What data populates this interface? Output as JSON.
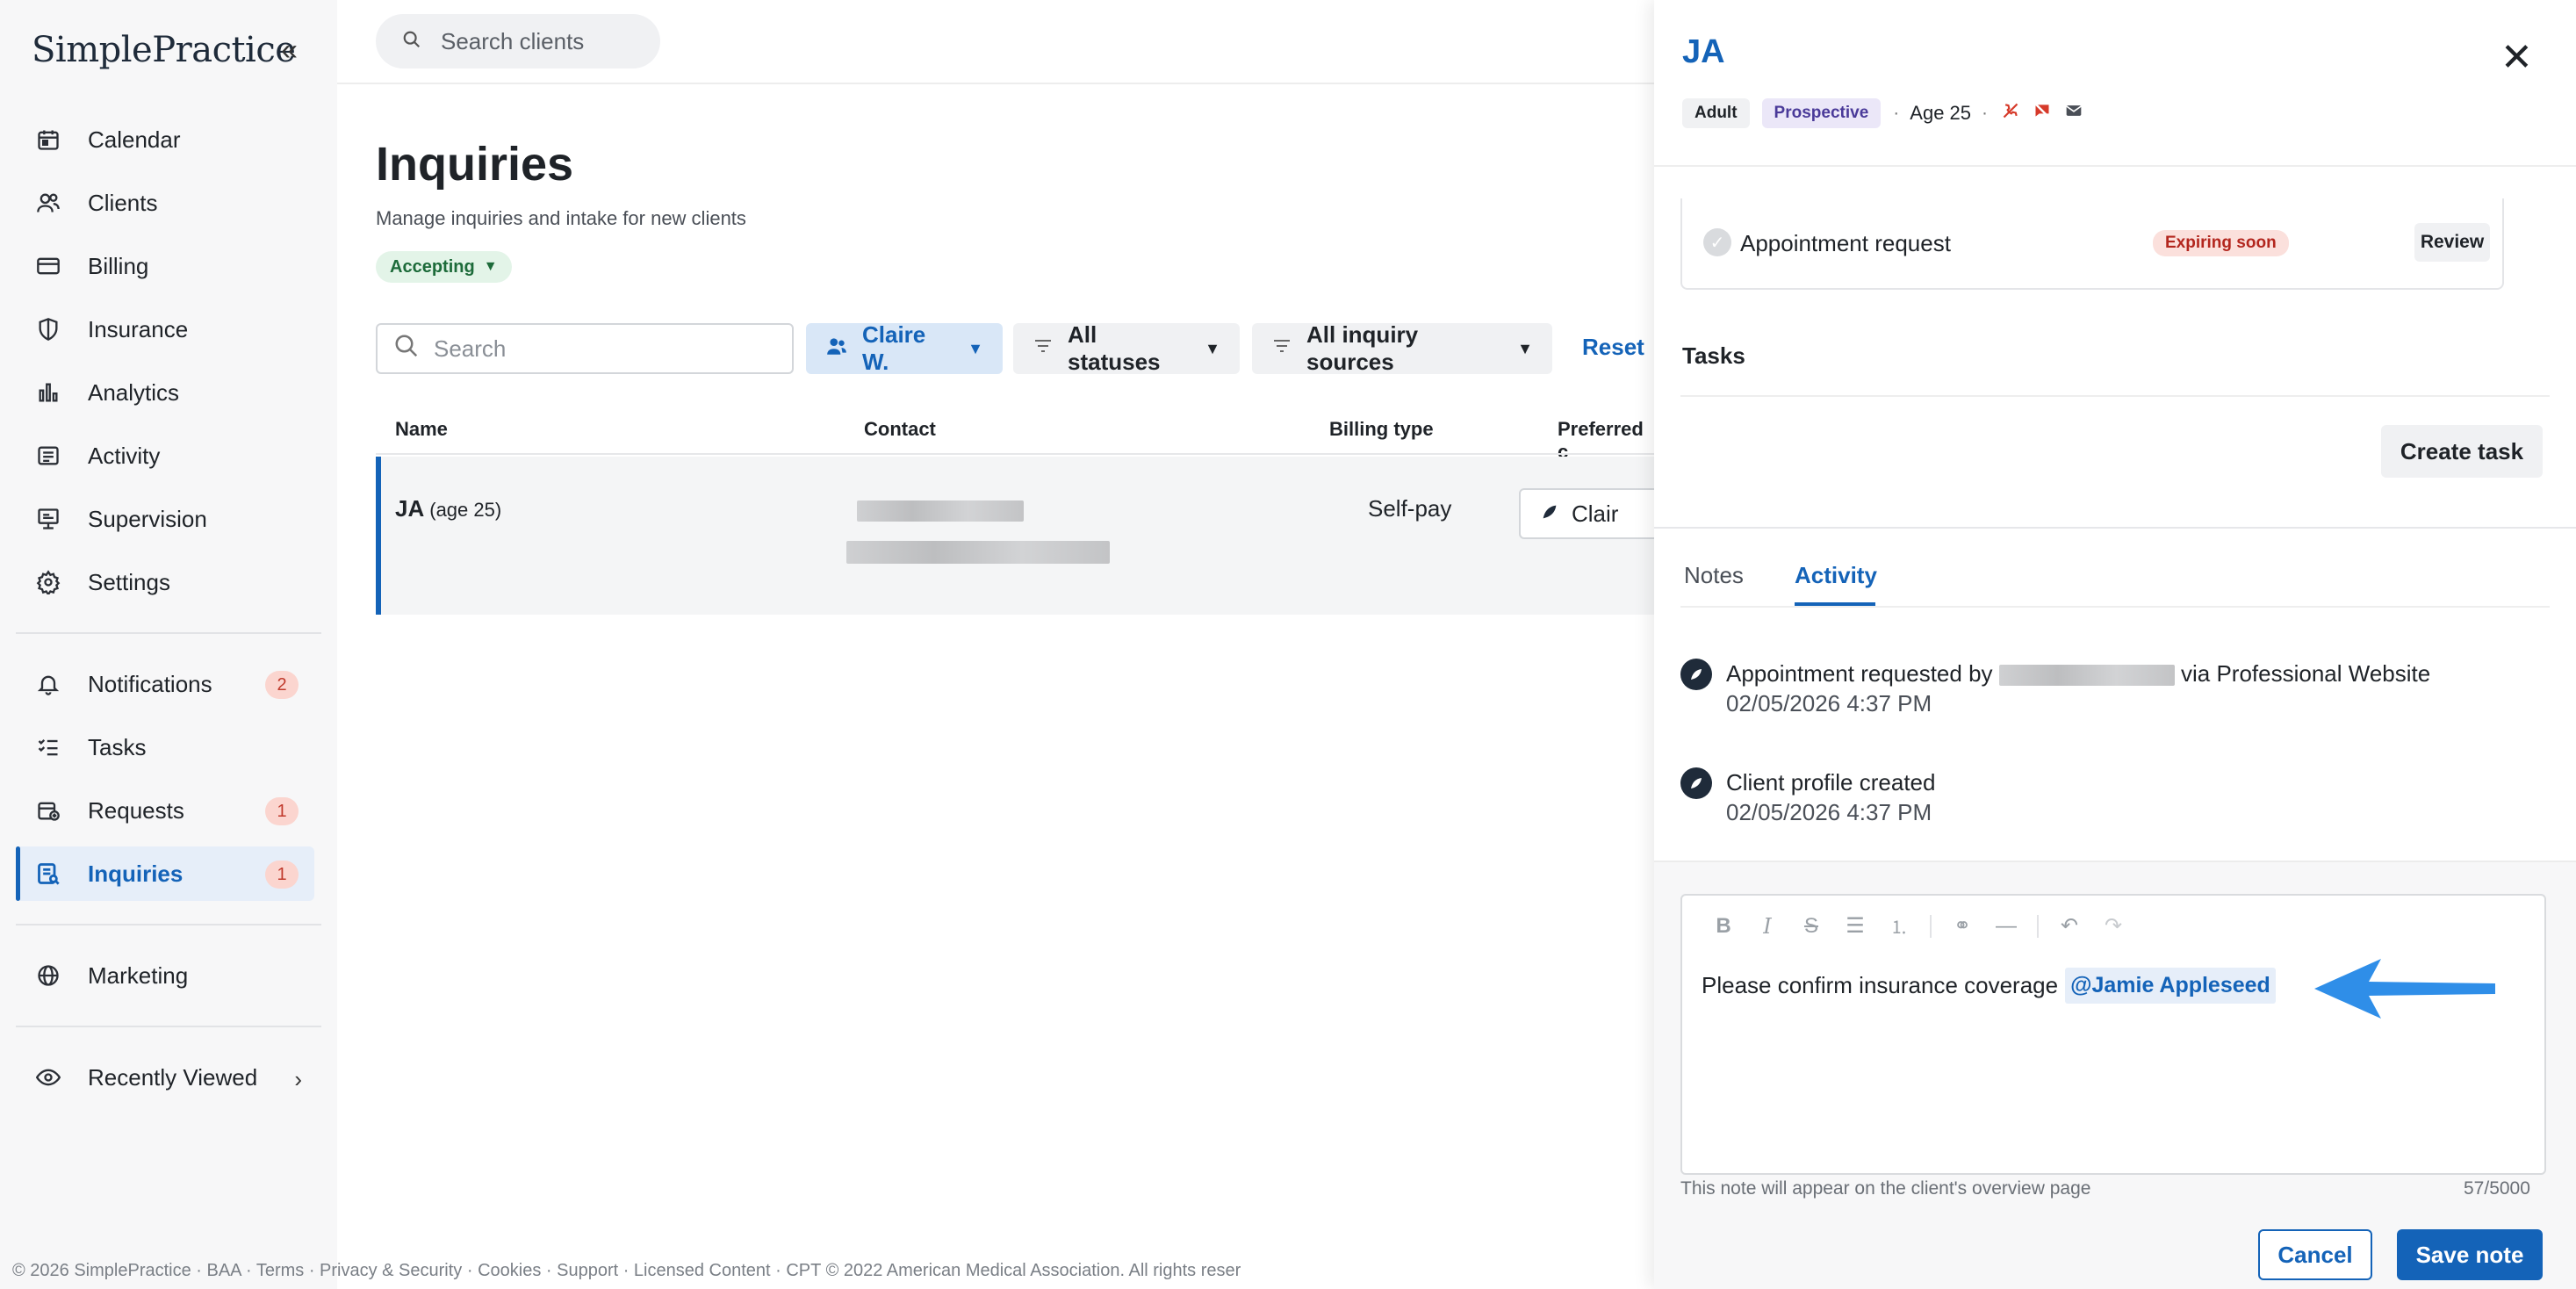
{
  "app": {
    "logo": "SimplePractice",
    "collapse_icon": "double-chevron-left-icon"
  },
  "sidebar": {
    "items": [
      {
        "label": "Calendar",
        "icon": "calendar-icon"
      },
      {
        "label": "Clients",
        "icon": "clients-icon"
      },
      {
        "label": "Billing",
        "icon": "billing-icon"
      },
      {
        "label": "Insurance",
        "icon": "shield-icon"
      },
      {
        "label": "Analytics",
        "icon": "bar-chart-icon"
      },
      {
        "label": "Activity",
        "icon": "activity-icon"
      },
      {
        "label": "Supervision",
        "icon": "supervision-icon"
      },
      {
        "label": "Settings",
        "icon": "gear-icon"
      }
    ],
    "items2": [
      {
        "label": "Notifications",
        "badge": "2",
        "icon": "bell-icon"
      },
      {
        "label": "Tasks",
        "icon": "tasks-icon"
      },
      {
        "label": "Requests",
        "badge": "1",
        "icon": "requests-icon"
      },
      {
        "label": "Inquiries",
        "badge": "1",
        "icon": "inquiries-icon",
        "active": true
      }
    ],
    "items3": [
      {
        "label": "Marketing",
        "icon": "globe-icon"
      }
    ],
    "items4": [
      {
        "label": "Recently Viewed",
        "icon": "eye-icon"
      }
    ]
  },
  "topbar": {
    "search_placeholder": "Search clients"
  },
  "page": {
    "title": "Inquiries",
    "subtitle": "Manage inquiries and intake for new clients",
    "status_pill": "Accepting"
  },
  "filters": {
    "search_placeholder": "Search",
    "clinician": "Claire W.",
    "status": "All statuses",
    "source": "All inquiry sources",
    "reset": "Reset"
  },
  "table": {
    "columns": [
      "Name",
      "Contact",
      "Billing type",
      "Preferred c"
    ],
    "rows": [
      {
        "name": "JA",
        "age": "(age 25)",
        "billing": "Self-pay",
        "preferred": "Clair"
      }
    ]
  },
  "footer": {
    "text": "© 2026 SimplePractice · BAA · Terms · Privacy & Security · Cookies · Support · Licensed Content · CPT © 2022 American Medical Association. All rights reser"
  },
  "drawer": {
    "title": "JA",
    "tags": {
      "adult": "Adult",
      "prospective": "Prospective"
    },
    "age": "Age 25",
    "request": {
      "label": "Appointment request",
      "status": "Expiring soon",
      "action": "Review"
    },
    "tasks": {
      "heading": "Tasks",
      "create": "Create task"
    },
    "tabs": {
      "notes": "Notes",
      "activity": "Activity"
    },
    "activity": [
      {
        "text_before": "Appointment requested by ",
        "text_after": " via Professional Website",
        "time": "02/05/2026 4:37 PM"
      },
      {
        "text": "Client profile created",
        "time": "02/05/2026 4:37 PM"
      }
    ],
    "editor": {
      "text": "Please confirm insurance coverage",
      "mention": "@Jamie Appleseed",
      "hint": "This note will appear on the client's overview page",
      "count": "57/5000"
    },
    "buttons": {
      "cancel": "Cancel",
      "save": "Save note"
    }
  },
  "colors": {
    "brand": "#1463b8",
    "badge_bg": "#fbd5cf",
    "success_bg": "#e3f4e8",
    "danger_bg": "#fbe0dc"
  }
}
